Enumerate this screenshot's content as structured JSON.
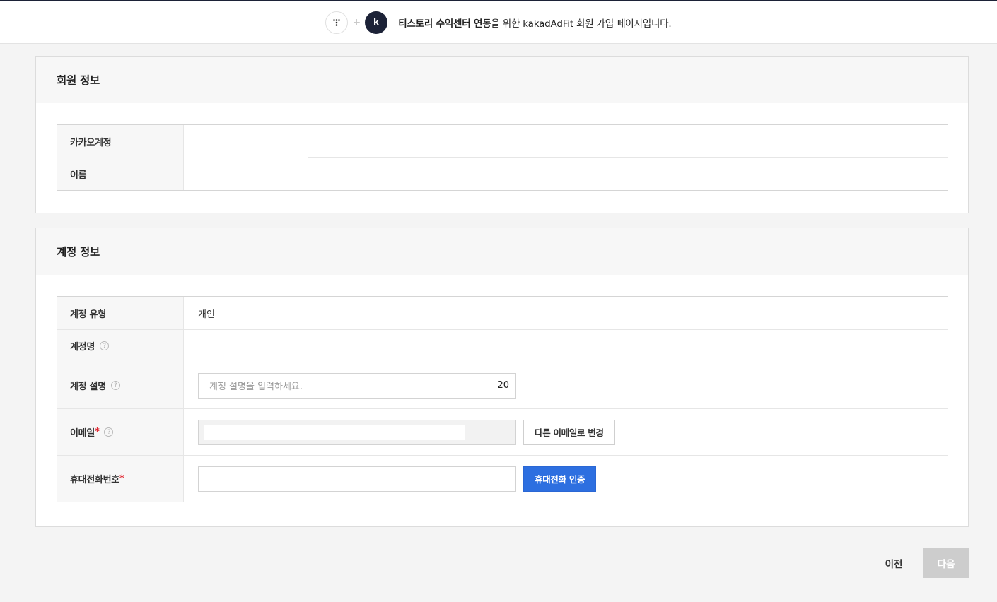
{
  "banner": {
    "plus": "+",
    "kakao_logo_letter": "k",
    "text_bold": "티스토리 수익센터 연동",
    "text_rest": "을 위한 kakadAdFit 회원 가입 페이지입니다."
  },
  "member_info": {
    "title": "회원 정보",
    "rows": [
      {
        "label": "카카오계정",
        "value": ""
      },
      {
        "label": "이름",
        "value": ""
      }
    ]
  },
  "account_info": {
    "title": "계정 정보",
    "type": {
      "label": "계정 유형",
      "value": "개인"
    },
    "name": {
      "label": "계정명",
      "help": "?"
    },
    "description": {
      "label": "계정 설명",
      "help": "?",
      "placeholder": "계정 설명을 입력하세요.",
      "counter": "20"
    },
    "email": {
      "label": "이메일",
      "required": "*",
      "help": "?",
      "change_button": "다른 이메일로 변경"
    },
    "phone": {
      "label": "휴대전화번호",
      "required": "*",
      "verify_button": "휴대전화 인증"
    }
  },
  "footer": {
    "prev": "이전",
    "next": "다음"
  },
  "colors": {
    "brand_dark": "#1c2237",
    "primary": "#2d6fe0",
    "required": "#e0212b",
    "disabled_button": "#cdcdcd"
  },
  "icons": [
    "tistory-logo-icon",
    "kakao-logo-icon",
    "help-icon"
  ]
}
